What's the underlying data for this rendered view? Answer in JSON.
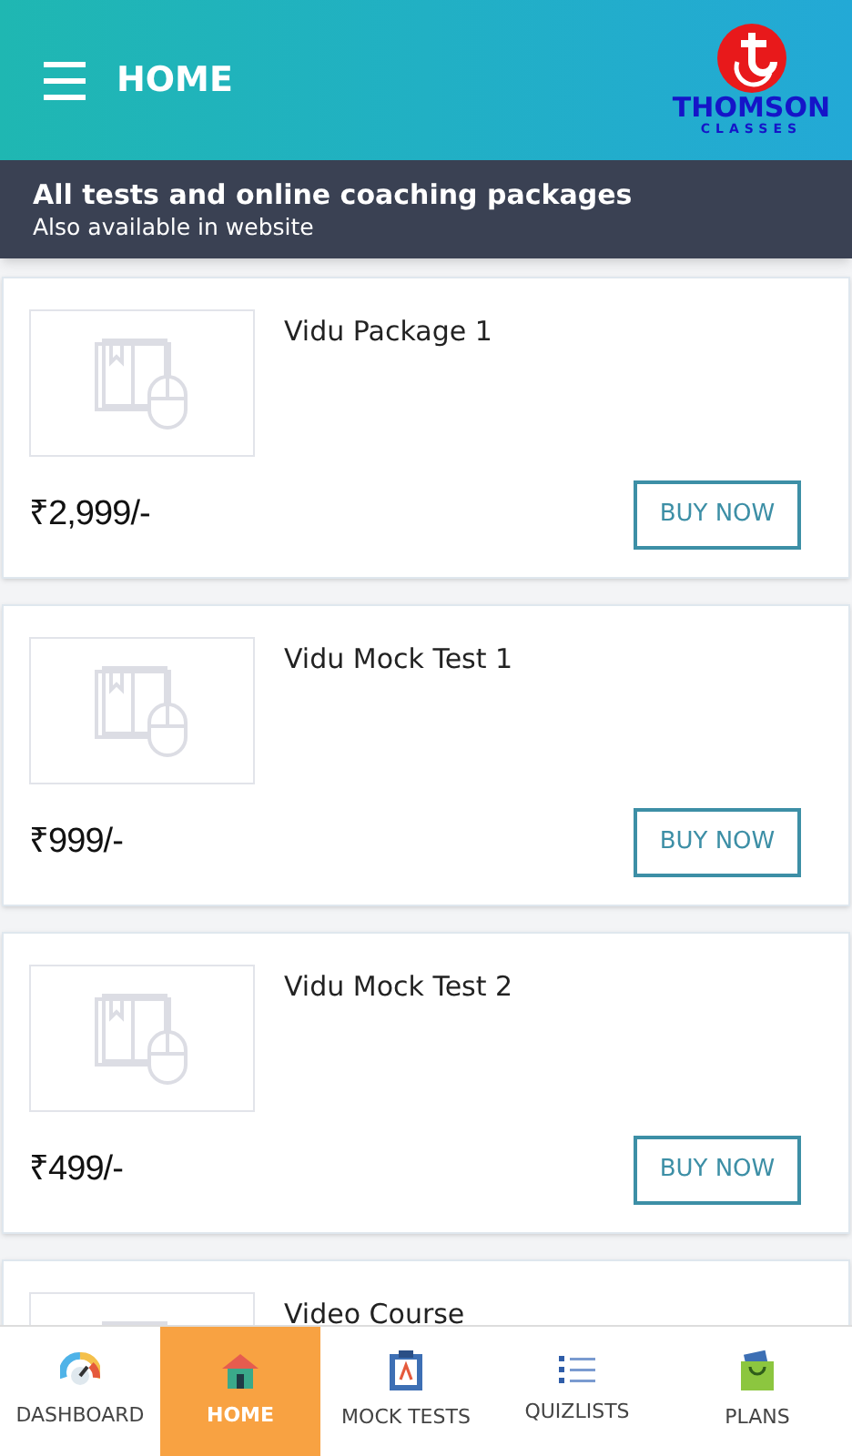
{
  "header": {
    "title": "HOME",
    "logo": {
      "name": "THOMSON",
      "tagline": "CLASSES"
    }
  },
  "banner": {
    "title": "All tests and online coaching packages",
    "subtitle": "Also available in website"
  },
  "products": [
    {
      "title": "Vidu Package 1",
      "price": "₹2,999/-",
      "button": "BUY NOW"
    },
    {
      "title": "Vidu Mock Test 1",
      "price": "₹999/-",
      "button": "BUY NOW"
    },
    {
      "title": "Vidu Mock Test 2",
      "price": "₹499/-",
      "button": "BUY NOW"
    },
    {
      "title": "Video Course"
    }
  ],
  "nav": [
    {
      "label": "DASHBOARD",
      "kind": "gauge",
      "selected": false
    },
    {
      "label": "HOME",
      "kind": "house",
      "selected": true
    },
    {
      "label": "MOCK TESTS",
      "kind": "clipboard",
      "selected": false
    },
    {
      "label": "QUIZLISTS",
      "kind": "list",
      "selected": false
    },
    {
      "label": "PLANS",
      "kind": "bag",
      "selected": false
    }
  ]
}
